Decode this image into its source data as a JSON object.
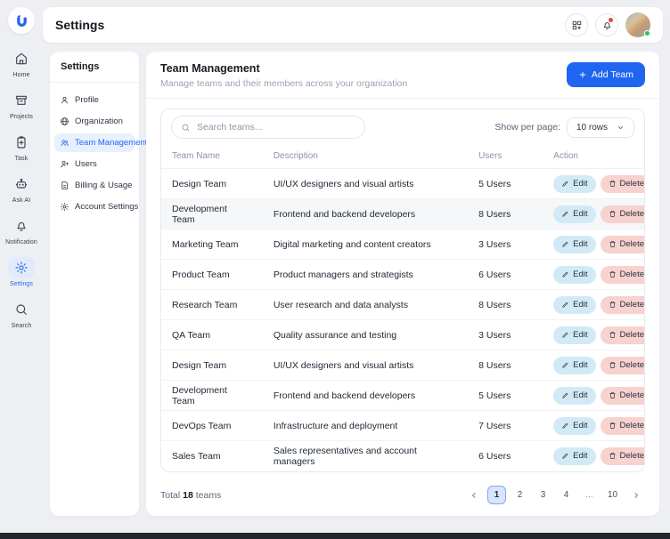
{
  "colors": {
    "accent_blue": "#2065f0",
    "active_item_bg": "#e7f0fd",
    "edit_chip_bg": "#d2eaf6",
    "delete_chip_bg": "#f8d2ce",
    "page_active_bg": "#d9e6fa",
    "notification_dot": "#e5484d",
    "online_dot": "#22c55e"
  },
  "topbar": {
    "title": "Settings"
  },
  "rail": {
    "items": [
      {
        "label": "Home",
        "icon": "home",
        "active": false
      },
      {
        "label": "Projects",
        "icon": "projects",
        "active": false
      },
      {
        "label": "Task",
        "icon": "task",
        "active": false
      },
      {
        "label": "Ask AI",
        "icon": "askai",
        "active": false
      },
      {
        "label": "Notification",
        "icon": "bell",
        "active": false
      },
      {
        "label": "Settings",
        "icon": "gear",
        "active": true
      },
      {
        "label": "Search",
        "icon": "search",
        "active": false
      }
    ]
  },
  "settings_nav": {
    "title": "Settings",
    "items": [
      {
        "label": "Profile",
        "icon": "user",
        "active": false
      },
      {
        "label": "Organization",
        "icon": "globe",
        "active": false
      },
      {
        "label": "Team Management",
        "icon": "users",
        "active": true
      },
      {
        "label": "Users",
        "icon": "userplus",
        "active": false
      },
      {
        "label": "Billing & Usage",
        "icon": "billing",
        "active": false
      },
      {
        "label": "Account Settings",
        "icon": "gear",
        "active": false
      }
    ]
  },
  "main": {
    "title": "Team Management",
    "subtitle": "Manage teams and their members across your organization",
    "add_button_label": "Add Team",
    "search_placeholder": "Search teams...",
    "per_page_label": "Show per page:",
    "per_page_value": "10 rows",
    "table": {
      "headers": [
        "Team Name",
        "Description",
        "Users",
        "Action"
      ],
      "actions": {
        "edit": "Edit",
        "delete": "Delete"
      },
      "rows": [
        {
          "name": "Design Team",
          "description": "UI/UX designers and visual artists",
          "users": "5 Users",
          "highlighted": false
        },
        {
          "name": "Development Team",
          "description": "Frontend and backend developers",
          "users": "8 Users",
          "highlighted": true
        },
        {
          "name": "Marketing Team",
          "description": "Digital marketing and content creators",
          "users": "3 Users",
          "highlighted": false
        },
        {
          "name": "Product Team",
          "description": "Product managers and strategists",
          "users": "6 Users",
          "highlighted": false
        },
        {
          "name": "Research Team",
          "description": "User research and data analysts",
          "users": "8 Users",
          "highlighted": false
        },
        {
          "name": "QA Team",
          "description": "Quality assurance and testing",
          "users": "3 Users",
          "highlighted": false
        },
        {
          "name": "Design Team",
          "description": "UI/UX designers and visual artists",
          "users": "8 Users",
          "highlighted": false
        },
        {
          "name": "Development Team",
          "description": "Frontend and backend developers",
          "users": "5 Users",
          "highlighted": false
        },
        {
          "name": "DevOps Team",
          "description": "Infrastructure and deployment",
          "users": "7 Users",
          "highlighted": false
        },
        {
          "name": "Sales Team",
          "description": "Sales representatives and account managers",
          "users": "6 Users",
          "highlighted": false
        }
      ]
    },
    "footer": {
      "total_prefix": "Total",
      "total_count": "18",
      "total_suffix": "teams",
      "pages": [
        "1",
        "2",
        "3",
        "4",
        "...",
        "10"
      ],
      "active_page": "1"
    }
  }
}
